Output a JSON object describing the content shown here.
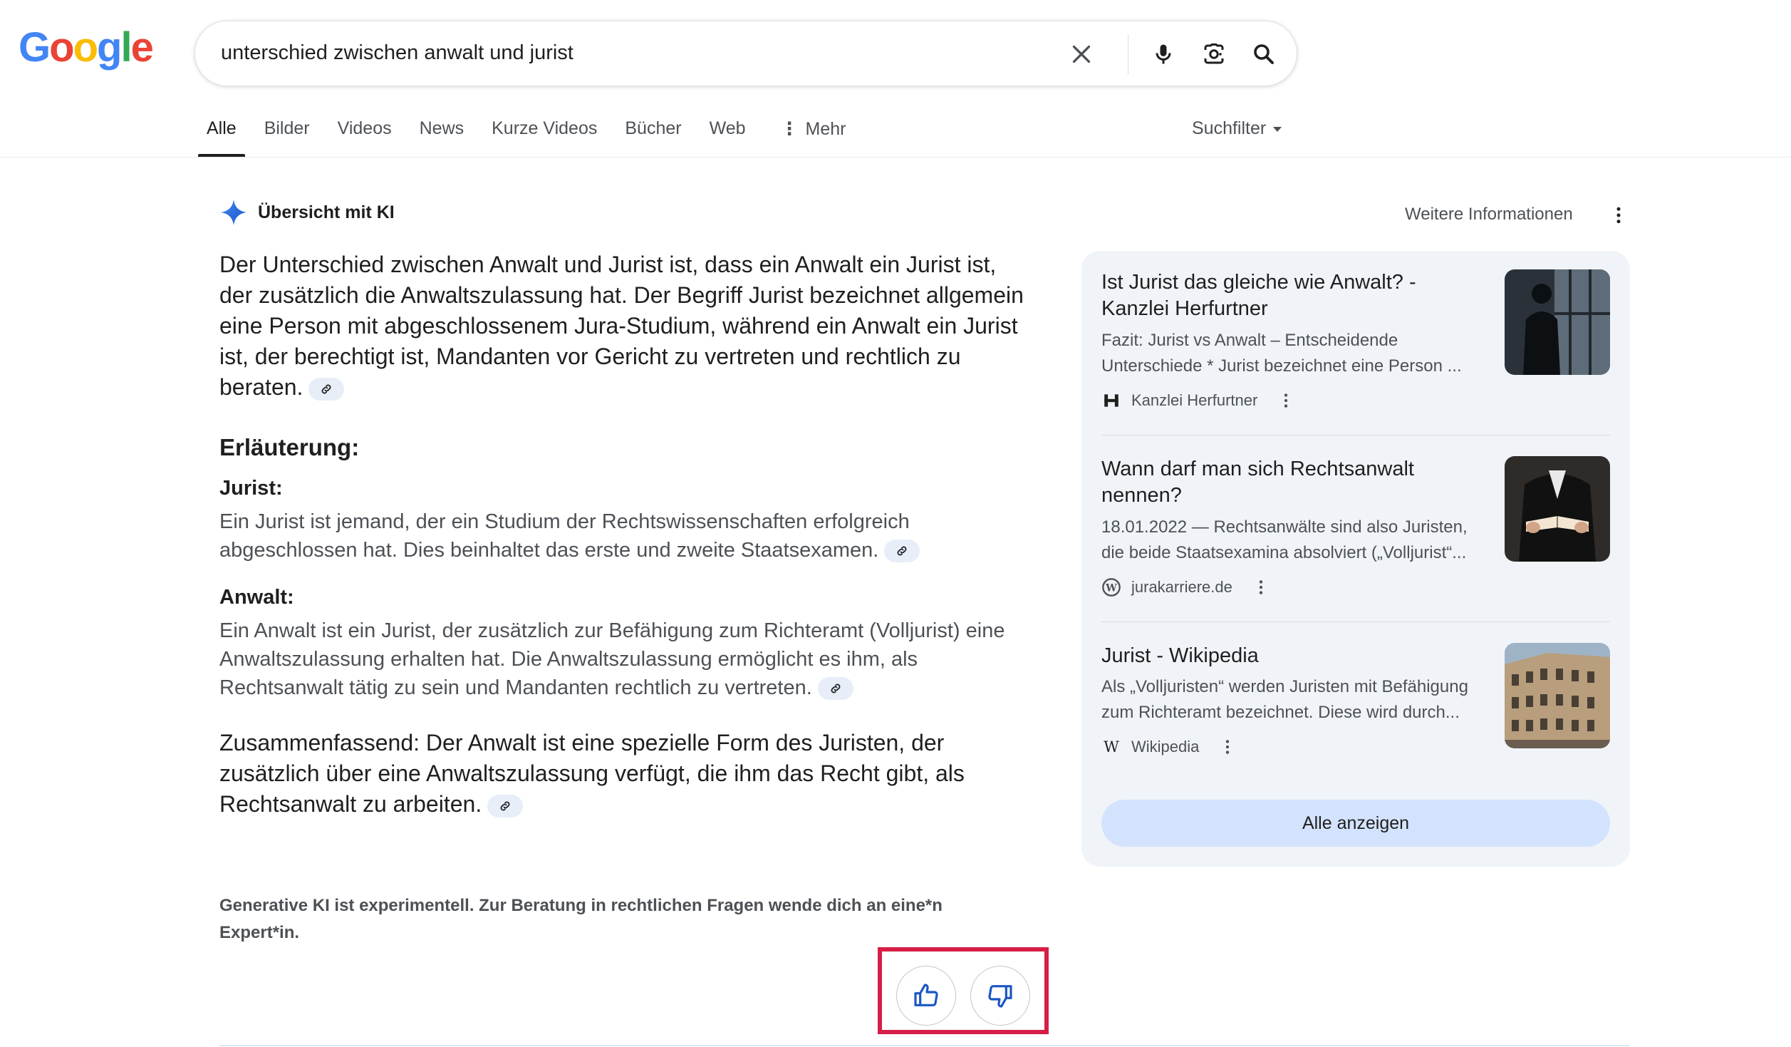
{
  "logo": {
    "letters": [
      "G",
      "o",
      "o",
      "g",
      "l",
      "e"
    ]
  },
  "search": {
    "query": "unterschied zwischen anwalt und jurist"
  },
  "tabs": [
    {
      "label": "Alle"
    },
    {
      "label": "Bilder"
    },
    {
      "label": "Videos"
    },
    {
      "label": "News"
    },
    {
      "label": "Kurze Videos"
    },
    {
      "label": "Bücher"
    },
    {
      "label": "Web"
    },
    {
      "label": "Mehr"
    }
  ],
  "suchfilter": "Suchfilter",
  "ai": {
    "title": "Übersicht mit KI",
    "more_info": "Weitere Informationen",
    "lead": "Der Unterschied zwischen Anwalt und Jurist ist, dass ein Anwalt ein Jurist ist, der zusätzlich die Anwaltszulassung hat. Der Begriff Jurist bezeichnet allgemein eine Person mit abgeschlossenem Jura-Studium, während ein Anwalt ein Jurist ist, der berechtigt ist, Mandanten vor Gericht zu vertreten und rechtlich zu beraten.",
    "explanation_heading": "Erläuterung:",
    "jurist_heading": "Jurist:",
    "jurist_text": "Ein Jurist ist jemand, der ein Studium der Rechtswissenschaften erfolgreich abgeschlossen hat. Dies beinhaltet das erste und zweite Staatsexamen.",
    "anwalt_heading": "Anwalt:",
    "anwalt_text": "Ein Anwalt ist ein Jurist, der zusätzlich zur Befähigung zum Richteramt (Volljurist) eine Anwaltszulassung erhalten hat. Die Anwaltszulassung ermöglicht es ihm, als Rechtsanwalt tätig zu sein und Mandanten rechtlich zu vertreten.",
    "summary": "Zusammenfassend: Der Anwalt ist eine spezielle Form des Juristen, der zusätzlich über eine Anwaltszulassung verfügt, die ihm das Recht gibt, als Rechtsanwalt zu arbeiten.",
    "disclaimer": "Generative KI ist experimentell. Zur Beratung in rechtlichen Fragen wende dich an eine*n Expert*in."
  },
  "sources": [
    {
      "title": "Ist Jurist das gleiche wie Anwalt? - Kanzlei Herfurtner",
      "snippet": "Fazit: Jurist vs Anwalt – Entscheidende Unterschiede * Jurist bezeichnet eine Person ...",
      "site": "Kanzlei Herfurtner",
      "favicon": "H"
    },
    {
      "title": "Wann darf man sich Rechtsanwalt nennen?",
      "snippet": "18.01.2022 — Rechtsanwälte sind also Juristen, die beide Staatsexamina absolviert („Volljurist“...",
      "site": "jurakarriere.de",
      "favicon": "W"
    },
    {
      "title": "Jurist - Wikipedia",
      "snippet": "Als „Volljuristen“ werden Juristen mit Befähigung zum Richteramt bezeichnet. Diese wird durch...",
      "site": "Wikipedia",
      "favicon": "W"
    }
  ],
  "show_all": "Alle anzeigen",
  "colors": {
    "accent": "#1a56c4",
    "highlight_border": "#d61e46",
    "panel_bg": "#f0f4f9",
    "button_bg": "#d3e3fd"
  }
}
